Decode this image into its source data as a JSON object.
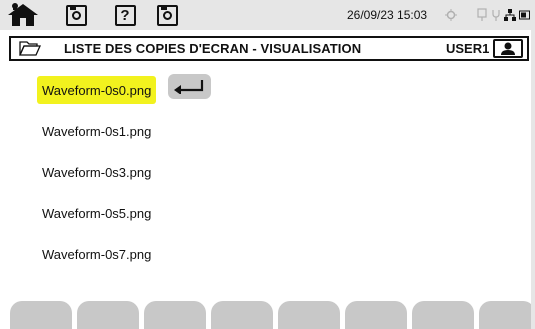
{
  "status_bar": {
    "datetime": "26/09/23 15:03",
    "icons": [
      "home-icon",
      "camera-icon",
      "help-icon",
      "camera-icon",
      "gps-icon",
      "usb-icon",
      "network-icon",
      "battery-icon"
    ],
    "help_glyph": "?"
  },
  "title_bar": {
    "icon": "folder-icon",
    "title": "LISTE DES COPIES D'ECRAN - VISUALISATION",
    "user": "USER1",
    "user_icon": "user-icon"
  },
  "file_list": {
    "items": [
      {
        "name": "Waveform-0s0.png",
        "selected": true
      },
      {
        "name": "Waveform-0s1.png",
        "selected": false
      },
      {
        "name": "Waveform-0s3.png",
        "selected": false
      },
      {
        "name": "Waveform-0s5.png",
        "selected": false
      },
      {
        "name": "Waveform-0s7.png",
        "selected": false
      }
    ],
    "enter_icon": "enter-icon"
  },
  "soft_keys": {
    "count": 8,
    "labels": [
      "",
      "",
      "",
      "",
      "",
      "",
      "",
      ""
    ]
  },
  "colors": {
    "selection": "#f2f21e",
    "button_gray": "#c8c8c8",
    "status_bg": "#e6e6e6",
    "text": "#111111"
  }
}
